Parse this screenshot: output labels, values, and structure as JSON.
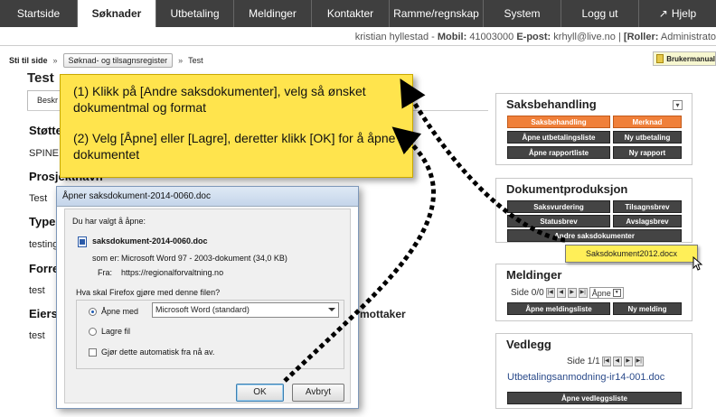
{
  "nav": {
    "tabs": [
      "Startside",
      "Søknader",
      "Utbetaling",
      "Meldinger",
      "Kontakter",
      "Ramme/regnskap",
      "System",
      "Logg ut"
    ],
    "help": "Hjelp"
  },
  "user": {
    "name": "kristian hyllestad",
    "mobile_label": "Mobil:",
    "mobile": "41003000",
    "email_label": "E-post:",
    "email": "krhyll@live.no",
    "roles_label": "[Roller:",
    "roles": "Administrato"
  },
  "breadcrumb": {
    "label": "Sti til side",
    "sep": "»",
    "link": "Søknad- og tilsagnsregister",
    "current": "Test"
  },
  "manual": "Brukermanual",
  "page": {
    "title": "Test",
    "subtab": "Beskr",
    "sections": [
      {
        "heading": "Støtte",
        "value": "SPINE A"
      },
      {
        "heading": "Prosjektnavn",
        "value": "Test"
      },
      {
        "heading": "Type",
        "value": "testing"
      },
      {
        "heading": "Forre",
        "value": "test"
      },
      {
        "heading": "Eiers",
        "value": "test"
      }
    ],
    "mottaker": "mottaker"
  },
  "callout": {
    "step1": "(1)  Klikk på [Andre saksdokumenter], velg så ønsket dokumentmal og format",
    "step2": "(2) Velg [Åpne] eller [Lagre], deretter klikk [OK] for å åpne dokumentet"
  },
  "saksbehandling": {
    "title": "Saksbehandling",
    "buttons": [
      "Saksbehandling",
      "Merknad",
      "Åpne utbetalingsliste",
      "Ny utbetaling",
      "Åpne rapportliste",
      "Ny rapport"
    ]
  },
  "dokument": {
    "title": "Dokumentproduksjon",
    "buttons": [
      "Saksvurdering",
      "Tilsagnsbrev",
      "Statusbrev",
      "Avslagsbrev",
      "Andre saksdokumenter"
    ],
    "popup_item": "Saksdokument2012.docx"
  },
  "meldinger": {
    "title": "Meldinger",
    "pager": "Side 0/0",
    "select": "Åpne",
    "buttons": [
      "Åpne meldingsliste",
      "Ny melding"
    ]
  },
  "vedlegg": {
    "title": "Vedlegg",
    "pager": "Side 1/1",
    "doc": "Utbetalingsanmodning-ir14-001.doc",
    "button": "Åpne vedleggsliste"
  },
  "dialog": {
    "title": "Åpner saksdokument-2014-0060.doc",
    "intro": "Du har valgt å åpne:",
    "filename": "saksdokument-2014-0060.doc",
    "type_label": "som er:",
    "type": "Microsoft Word 97 - 2003-dokument (34,0 KB)",
    "from_label": "Fra:",
    "from": "https://regionalforvaltning.no",
    "question": "Hva skal Firefox gjøre med denne filen?",
    "open_with": "Åpne med",
    "open_with_app": "Microsoft Word (standard)",
    "save": "Lagre fil",
    "auto": "Gjør dette automatisk fra nå av.",
    "ok": "OK",
    "cancel": "Avbryt"
  }
}
